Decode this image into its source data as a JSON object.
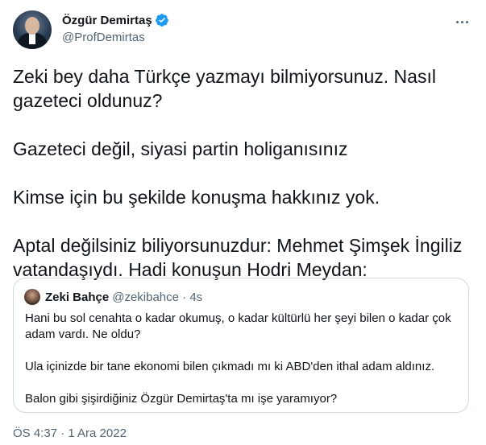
{
  "author": {
    "display_name": "Özgür Demirtaş",
    "handle": "@ProfDemirtas",
    "verified": true
  },
  "tweet": {
    "paragraphs": [
      "Zeki bey daha Türkçe yazmayı bilmiyorsunuz. Nasıl gazeteci oldunuz?",
      "Gazeteci değil, siyasi partin holiganısınız",
      "Kimse için bu şekilde konuşma hakkınız yok.",
      "Aptal değilsiniz biliyorsunuzdur: Mehmet Şimşek İngiliz vatandaşıydı. Hadi konuşun Hodri Meydan:"
    ],
    "timestamp": "ÖS 4:37 · 1 Ara 2022"
  },
  "quoted_tweet": {
    "display_name": "Zeki Bahçe",
    "meta": "@zekibahce · 4s",
    "paragraphs": [
      "Hani bu sol cenahta o kadar okumuş, o kadar kültürlü her şeyi bilen o kadar çok adam vardı. Ne oldu?",
      "Ula içinizde bir tane ekonomi bilen çıkmadı mı ki ABD'den ithal adam aldınız.",
      "Balon gibi şişirdiğiniz Özgür Demirtaş'ta mı işe yaramıyor?"
    ]
  },
  "icons": {
    "verified": "verified-badge-icon",
    "more": "more-horizontal-icon"
  },
  "colors": {
    "text_primary": "#0f1419",
    "text_secondary": "#536471",
    "verified_blue": "#1d9bf0",
    "border": "#cfd9de"
  }
}
